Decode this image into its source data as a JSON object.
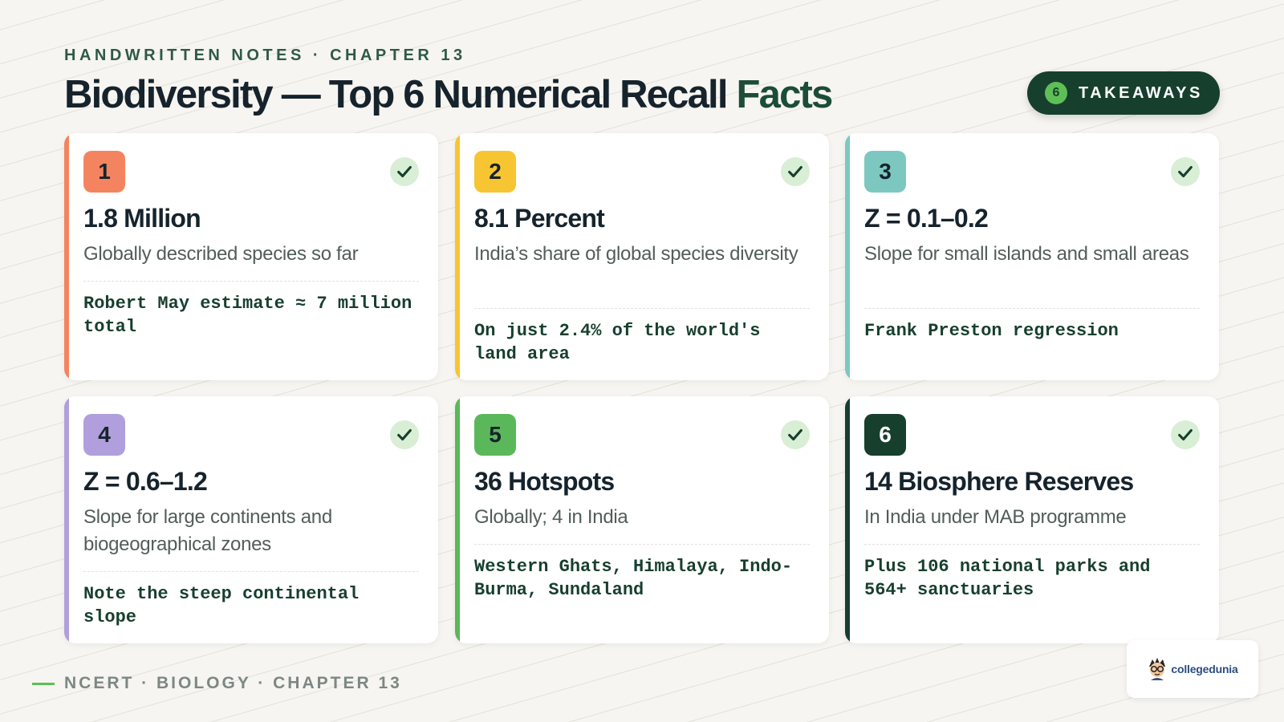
{
  "header": {
    "eyebrow": "HANDWRITTEN NOTES · CHAPTER 13",
    "title_main": "Biodiversity — Top 6 Numerical Recall",
    "title_accent": "Facts"
  },
  "badge": {
    "count": "6",
    "label": "TAKEAWAYS"
  },
  "cards": [
    {
      "number": "1",
      "heading": "1.8 Million",
      "description": "Globally described species so far",
      "note": "Robert May estimate ≈ 7 million total",
      "accent": "#f4845f",
      "number_text_color": "#16232c"
    },
    {
      "number": "2",
      "heading": "8.1 Percent",
      "description": "India’s share of global species diversity",
      "note": "On just 2.4% of the world's land area",
      "accent": "#f7c531",
      "number_text_color": "#16232c"
    },
    {
      "number": "3",
      "heading": "Z = 0.1–0.2",
      "description": "Slope for small islands and small areas",
      "note": "Frank Preston regression",
      "accent": "#7cc8c0",
      "number_text_color": "#16232c"
    },
    {
      "number": "4",
      "heading": "Z = 0.6–1.2",
      "description": "Slope for large continents and biogeographical zones",
      "note": "Note the steep continental slope",
      "accent": "#b09fdc",
      "number_text_color": "#16232c"
    },
    {
      "number": "5",
      "heading": "36 Hotspots",
      "description": "Globally; 4 in India",
      "note": "Western Ghats, Himalaya, Indo-Burma, Sundaland",
      "accent": "#5bb85a",
      "number_text_color": "#16232c"
    },
    {
      "number": "6",
      "heading": "14 Biosphere Reserves",
      "description": "In India under MAB programme",
      "note": "Plus 106 national parks and 564+ sanctuaries",
      "accent": "#173f2e",
      "number_text_color": "#ffffff"
    }
  ],
  "footer": {
    "text": "NCERT · BIOLOGY · CHAPTER 13"
  },
  "logo": {
    "text": "collegedunia"
  },
  "icons": {
    "check": "checkmark-icon",
    "logo": "mascot-icon"
  },
  "colors": {
    "brand_dark": "#173f2e",
    "brand_green": "#5fbf57",
    "check_bg": "#d8eed5"
  }
}
